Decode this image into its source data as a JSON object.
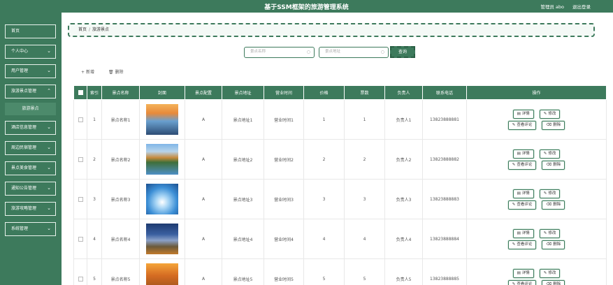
{
  "app": {
    "title": "基于SSM框架的旅游管理系统",
    "user_label": "管理员 abo",
    "logout_label": "退出登录"
  },
  "sidebar": {
    "items": [
      {
        "label": "首页",
        "chevron": false
      },
      {
        "label": "个人中心",
        "chevron": true
      },
      {
        "label": "用户管理",
        "chevron": true
      },
      {
        "label": "旅游景点管理",
        "chevron": true
      },
      {
        "label": "酒店信息管理",
        "chevron": true
      },
      {
        "label": "周边民宿管理",
        "chevron": true
      },
      {
        "label": "景点美食管理",
        "chevron": true
      },
      {
        "label": "通知公告管理",
        "chevron": true
      },
      {
        "label": "旅游攻略管理",
        "chevron": true
      },
      {
        "label": "系统管理",
        "chevron": true
      }
    ],
    "active_sub": "旅游景点"
  },
  "breadcrumb": {
    "home": "首页",
    "current": "旅游景点"
  },
  "search": {
    "name_placeholder": "景点名称",
    "address_placeholder": "景点地址",
    "button": "查询"
  },
  "actions": {
    "add": "新增",
    "delete": "删除"
  },
  "table": {
    "headers": [
      "索引",
      "景点名称",
      "封面",
      "景点配置",
      "景点地址",
      "营业时间",
      "价格",
      "票数",
      "负责人",
      "联系电话",
      "操作"
    ],
    "ops": {
      "detail": "详情",
      "edit": "修改",
      "comments": "查看评论",
      "delete": "删除"
    },
    "rows": [
      {
        "index": "1",
        "name": "景点名称1",
        "config": "A",
        "address": "景点地址1",
        "hours": "营业时间1",
        "price": "1",
        "tickets": "1",
        "owner": "负责人1",
        "phone": "13823888881",
        "cover": "sunset-lake"
      },
      {
        "index": "2",
        "name": "景点名称2",
        "config": "A",
        "address": "景点地址2",
        "hours": "营业时间2",
        "price": "2",
        "tickets": "2",
        "owner": "负责人2",
        "phone": "13823888882",
        "cover": "mountain-lake"
      },
      {
        "index": "3",
        "name": "景点名称3",
        "config": "A",
        "address": "景点地址3",
        "hours": "营业时间3",
        "price": "3",
        "tickets": "3",
        "owner": "负责人3",
        "phone": "13823888883",
        "cover": "blue-glow"
      },
      {
        "index": "4",
        "name": "景点名称4",
        "config": "A",
        "address": "景点地址4",
        "hours": "营业时间4",
        "price": "4",
        "tickets": "4",
        "owner": "负责人4",
        "phone": "13823888884",
        "cover": "night-mountain"
      },
      {
        "index": "5",
        "name": "景点名称5",
        "config": "A",
        "address": "景点地址5",
        "hours": "营业时间5",
        "price": "5",
        "tickets": "5",
        "owner": "负责人5",
        "phone": "13823888885",
        "cover": "autumn-forest"
      }
    ]
  },
  "colors": {
    "primary": "#3d7a5c",
    "primary_dark": "#2a5f44"
  }
}
